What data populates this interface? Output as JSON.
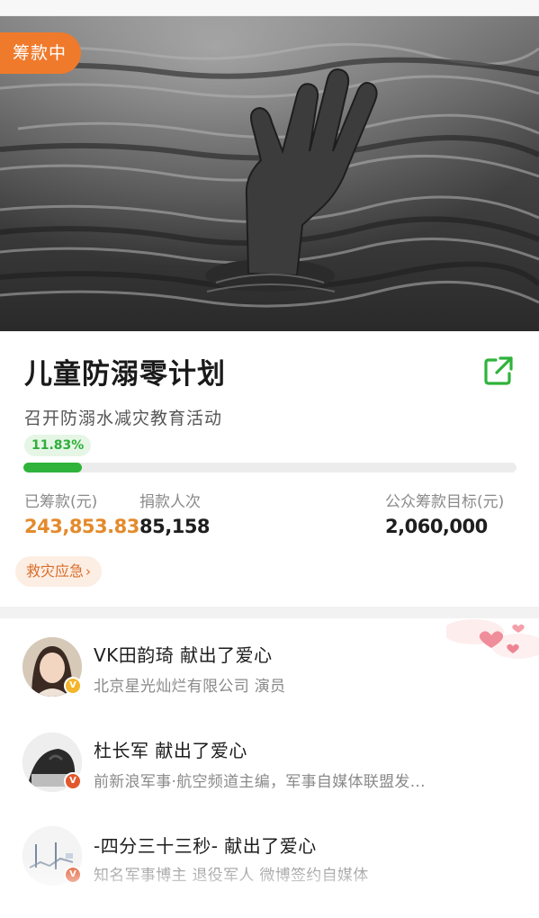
{
  "status_badge": "筹款中",
  "project": {
    "title": "儿童防溺零计划",
    "subtitle": "召开防溺水减灾教育活动",
    "progress_percent": 11.83,
    "progress_label": "11.83%"
  },
  "stats": {
    "raised_label": "已筹款(元)",
    "raised_value": "243,853.83",
    "donors_label": "捐款人次",
    "donors_value": "85,158",
    "goal_label": "公众筹款目标(元)",
    "goal_value": "2,060,000"
  },
  "category_tag": "救灾应急",
  "donors": [
    {
      "name": "VK田韵琦 献出了爱心",
      "desc": "北京星光灿烂有限公司 演员",
      "verify_badge": "V",
      "badge_color": "#f3b52a"
    },
    {
      "name": "杜长军 献出了爱心",
      "desc": "前新浪军事·航空频道主编，军事自媒体联盟发...",
      "verify_badge": "V",
      "badge_color": "#e2572b"
    },
    {
      "name": "-四分三十三秒- 献出了爱心",
      "desc": "知名军事博主 退役军人 微博签约自媒体",
      "verify_badge": "V",
      "badge_color": "#e2572b"
    }
  ],
  "icons": {
    "share": "share-external-icon",
    "tag_arrow": "chevron-right-icon"
  },
  "colors": {
    "accent_green": "#2fb33b",
    "accent_orange": "#f07a2b",
    "raised_orange": "#e48a2c"
  }
}
